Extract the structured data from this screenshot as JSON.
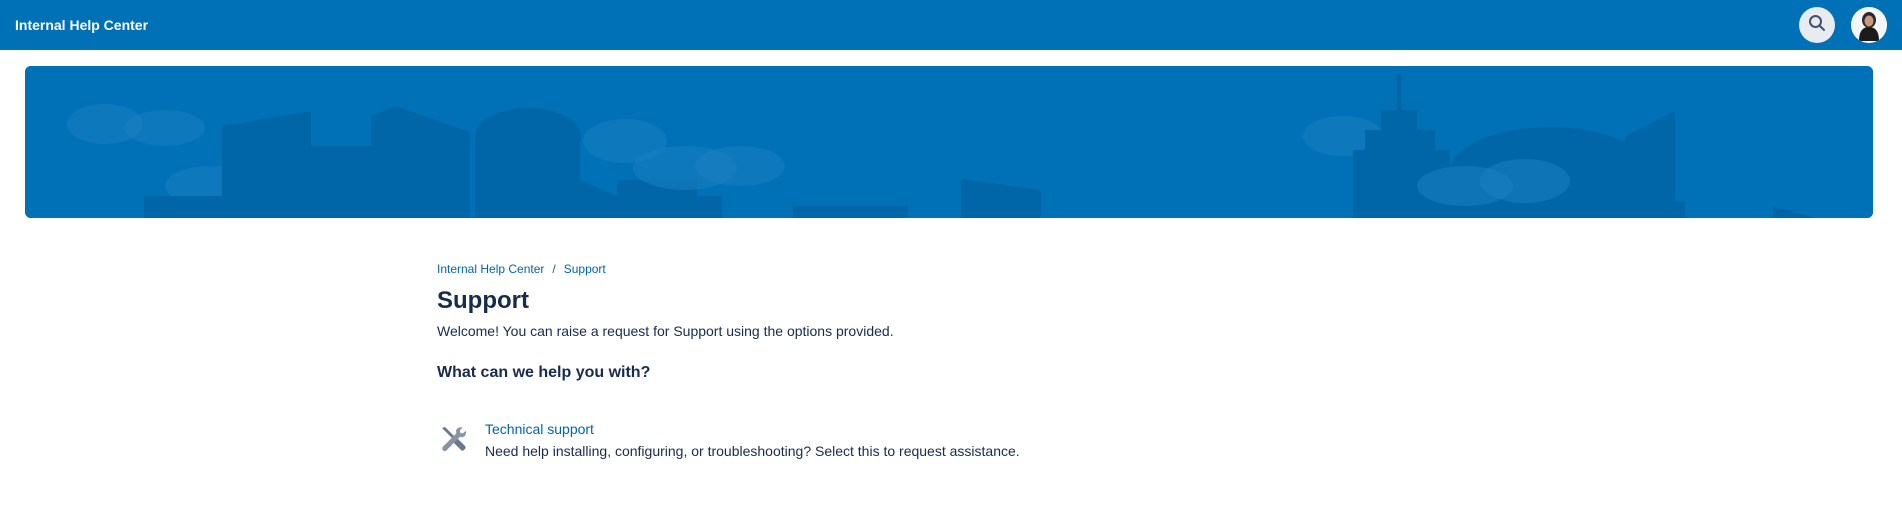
{
  "header": {
    "brand": "Internal Help Center",
    "search_icon": "search-icon",
    "avatar": "user-avatar"
  },
  "banner": {
    "background_color": "#0070b7",
    "illustration": "city-skyline-with-clouds"
  },
  "breadcrumb": {
    "items": [
      "Internal Help Center",
      "Support"
    ],
    "separator": "/"
  },
  "page": {
    "title": "Support",
    "welcome": "Welcome! You can raise a request for Support using the options provided.",
    "section_heading": "What can we help you with?"
  },
  "request_types": [
    {
      "icon": "tools-icon",
      "title": "Technical support",
      "description": "Need help installing, configuring, or troubleshooting? Select this to request assistance."
    }
  ],
  "colors": {
    "brand": "#0070b7",
    "link": "#0065a8",
    "text": "#172b4d"
  }
}
